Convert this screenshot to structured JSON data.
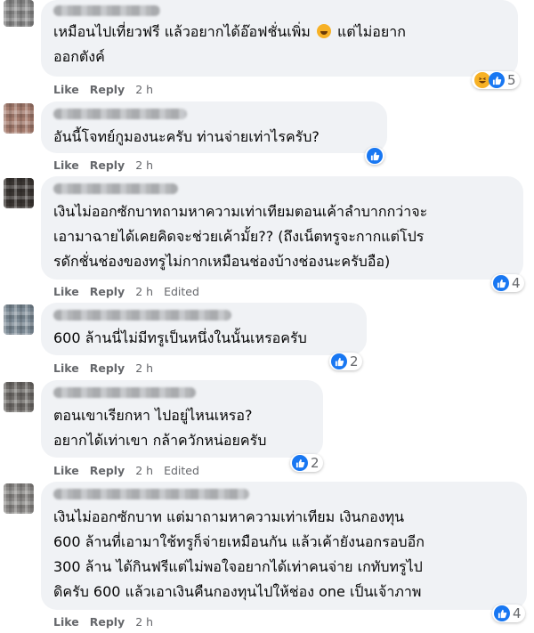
{
  "labels": {
    "like": "Like",
    "reply": "Reply",
    "edited": "Edited"
  },
  "comments": [
    {
      "lines": [
        "เหมือนไปเที่ยวฟรี แล้วอยากได้อ๊อฟชั่นเพิ่ม",
        "แต่ไม่อยาก",
        "ออกตังค์"
      ],
      "emoji": "grinning-squint-emoji",
      "time": "2 h",
      "reactions": [
        "haha",
        "like"
      ],
      "count": "5"
    },
    {
      "lines": [
        "อันนี้โจทย์กูมองนะครับ ท่านจ่ายเท่าไรครับ?"
      ],
      "time": "2 h",
      "reactions": [
        "like"
      ],
      "count": ""
    },
    {
      "lines": [
        "เงินไม่ออกซักบาทถามหาความเท่าเทียมตอนเค้าลำบากกว่าจะ",
        "เอามาฉายได้เคยคิดจะช่วยเค้ามั้ย?? (ถึงเน็ตทรูจะกากแต่โปร",
        "รดักชั่นช่องของทรูไม่กากเหมือนช่องบ้างช่องนะครับอือ)"
      ],
      "time": "2 h",
      "edited": true,
      "reactions": [
        "like"
      ],
      "count": "4"
    },
    {
      "lines": [
        "600 ล้านนี่ไม่มีทรูเป็นหนึ่งในนั้นเหรอครับ"
      ],
      "time": "2 h",
      "reactions": [
        "like"
      ],
      "count": "2"
    },
    {
      "lines": [
        "ตอนเขาเรียกหา ไปอยู่ไหนเหรอ?",
        "อยากได้เท่าเขา กล้าควักหน่อยครับ"
      ],
      "time": "2 h",
      "edited": true,
      "reactions": [
        "like"
      ],
      "count": "2"
    },
    {
      "lines": [
        "เงินไม่ออกซักบาท แต่มาถามหาความเท่าเทียม เงินกองทุน",
        "600 ล้านที่เอามาใช้ทรูก็จ่ายเหมือนกัน แล้วเค้ายังนอกรอบอีก",
        "300 ล้าน ได้กินฟรีแต่ไม่พอใจอยากได้เท่าคนจ่าย เกทับทรูไป",
        "ดิครับ 600 แล้วเอาเงินคืนกองทุนไปให้ช่อง one เป็นเจ้าภาพ"
      ],
      "time": "2 h",
      "reactions": [
        "like"
      ],
      "count": "4"
    }
  ]
}
